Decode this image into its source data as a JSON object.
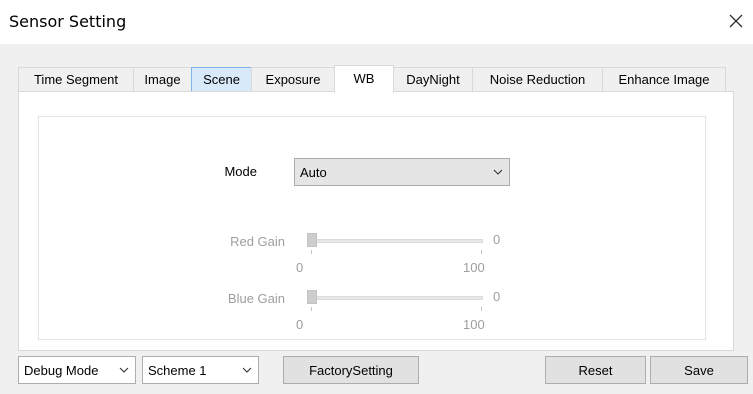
{
  "window": {
    "title": "Sensor Setting"
  },
  "tabs": [
    {
      "label": "Time Segment"
    },
    {
      "label": "Image"
    },
    {
      "label": "Scene"
    },
    {
      "label": "Exposure"
    },
    {
      "label": "WB"
    },
    {
      "label": "DayNight"
    },
    {
      "label": "Noise Reduction"
    },
    {
      "label": "Enhance Image"
    }
  ],
  "active_tab": "WB",
  "wb": {
    "mode_label": "Mode",
    "mode_value": "Auto",
    "red_gain": {
      "label": "Red Gain",
      "value": "0",
      "min": "0",
      "max": "100"
    },
    "blue_gain": {
      "label": "Blue Gain",
      "value": "0",
      "min": "0",
      "max": "100"
    }
  },
  "footer": {
    "debug_mode": "Debug Mode",
    "scheme": "Scheme 1",
    "factory_setting": "FactorySetting",
    "reset": "Reset",
    "save": "Save"
  },
  "colors": {
    "tab_hover": "#d8eaf9",
    "disabled_text": "#9e9e9e",
    "button_face": "#e1e1e1"
  }
}
